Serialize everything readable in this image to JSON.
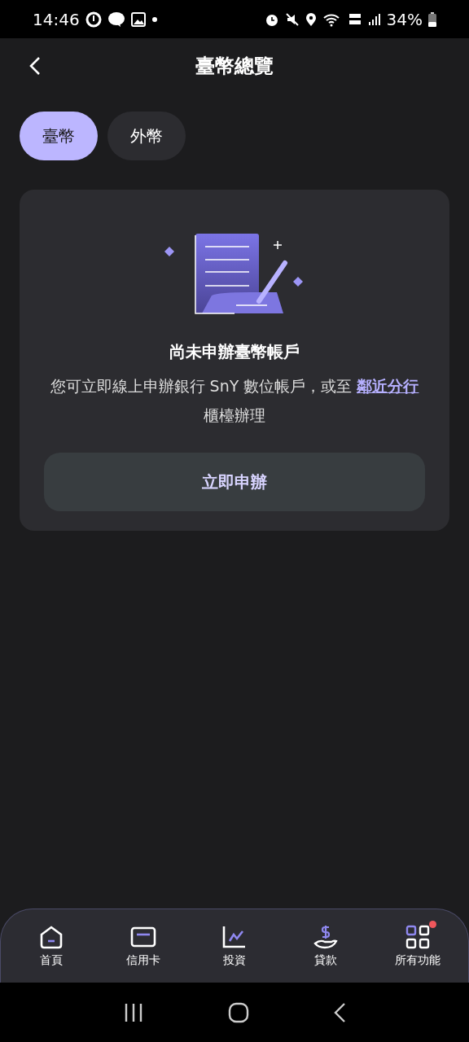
{
  "status_bar": {
    "time": "14:46",
    "battery": "34%"
  },
  "header": {
    "title": "臺幣總覽"
  },
  "tabs": [
    {
      "label": "臺幣",
      "selected": true
    },
    {
      "label": "外幣",
      "selected": false
    }
  ],
  "card": {
    "heading": "尚未申辦臺幣帳戶",
    "message_before": "您可立即線上申辦銀行 SnY 數位帳戶，或至",
    "link": "鄰近分行",
    "message_after": "櫃檯辦理",
    "button": "立即申辦"
  },
  "bottom_nav": [
    {
      "kind": "home",
      "label": "首頁",
      "notification_dot": false
    },
    {
      "kind": "card",
      "label": "信用卡",
      "notification_dot": false
    },
    {
      "kind": "chart",
      "label": "投資",
      "notification_dot": false
    },
    {
      "kind": "loan",
      "label": "貸款",
      "notification_dot": false
    },
    {
      "kind": "grid",
      "label": "所有功能",
      "notification_dot": true
    }
  ]
}
